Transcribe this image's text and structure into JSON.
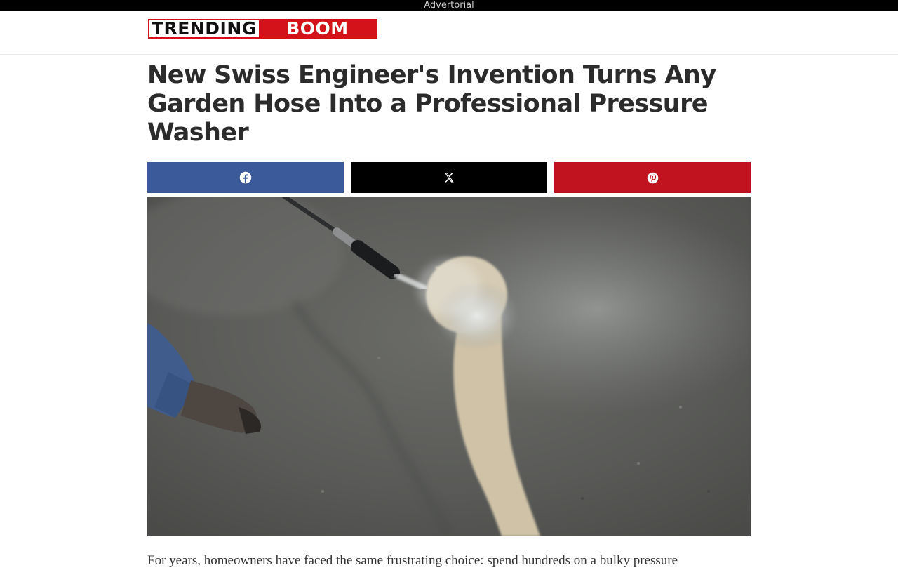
{
  "ad_label": "Advertorial",
  "brand": {
    "part1": "TRENDING",
    "part2": "BOOM",
    "accent_color": "#d4121a"
  },
  "article": {
    "headline": "New Swiss Engineer's Invention Turns Any Garden Hose Into a Professional Pressure Washer",
    "intro": "For years, homeowners have faced the same frustrating choice: spend hundreds on a bulky pressure"
  },
  "share": {
    "buttons": [
      {
        "network": "facebook",
        "icon": "facebook-icon",
        "color": "#3b5a9a"
      },
      {
        "network": "x",
        "icon": "x-icon",
        "color": "#000000"
      },
      {
        "network": "pinterest",
        "icon": "pinterest-icon",
        "color": "#c1121f"
      }
    ]
  },
  "hero_image": {
    "subject": "pressure-washer-cleaning-concrete-photo"
  }
}
